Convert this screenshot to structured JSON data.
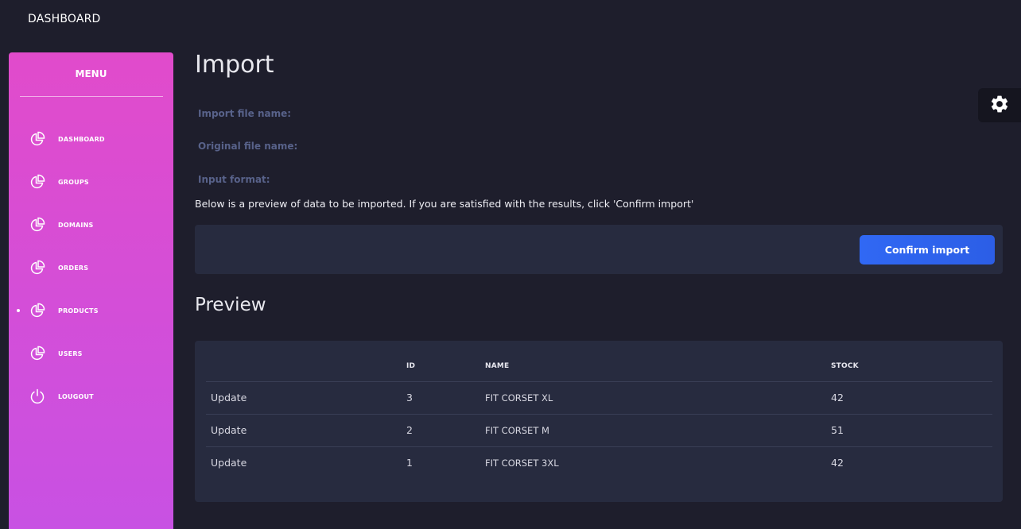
{
  "header": {
    "brand": "DASHBOARD"
  },
  "sidebar": {
    "title": "MENU",
    "items": [
      {
        "label": "DASHBOARD",
        "icon": "pie-chart-icon"
      },
      {
        "label": "GROUPS",
        "icon": "pie-chart-icon"
      },
      {
        "label": "DOMAINS",
        "icon": "pie-chart-icon"
      },
      {
        "label": "ORDERS",
        "icon": "pie-chart-icon"
      },
      {
        "label": "PRODUCTS",
        "icon": "pie-chart-icon",
        "active": true
      },
      {
        "label": "USERS",
        "icon": "pie-chart-icon"
      },
      {
        "label": "LOUGOUT",
        "icon": "power-icon"
      }
    ]
  },
  "main": {
    "title": "Import",
    "fields": {
      "import_file_name": "Import file name:",
      "original_file_name": "Original file name:",
      "input_format": "Input format:"
    },
    "note": "Below is a preview of data to be imported. If you are satisfied with the results, click 'Confirm import'",
    "confirm_label": "Confirm import",
    "preview_title": "Preview",
    "table": {
      "headers": [
        "",
        "ID",
        "NAME",
        "STOCK"
      ],
      "rows": [
        {
          "action": "Update",
          "id": "3",
          "name": "FIT CORSET XL",
          "stock": "42"
        },
        {
          "action": "Update",
          "id": "2",
          "name": "FIT CORSET M",
          "stock": "51"
        },
        {
          "action": "Update",
          "id": "1",
          "name": "FIT CORSET 3XL",
          "stock": "42"
        }
      ]
    }
  },
  "settings": {
    "icon": "gear-icon"
  },
  "colors": {
    "background": "#1e1e2c",
    "sidebar_gradient_top": "#e14bcb",
    "sidebar_gradient_bottom": "#c851e3",
    "card": "#272b3f",
    "accent": "#3068f4",
    "muted_label": "#58628a"
  }
}
